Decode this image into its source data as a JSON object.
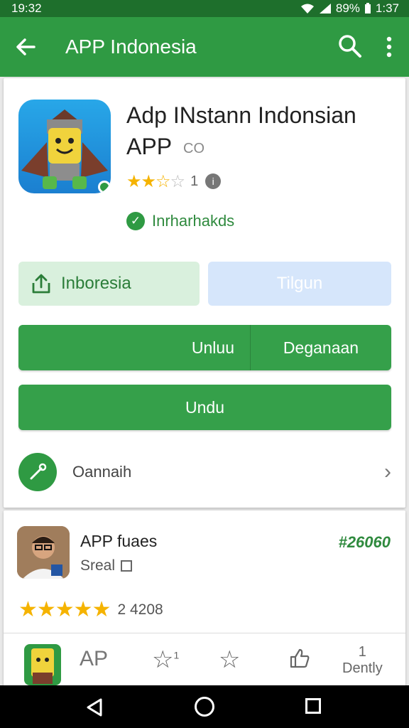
{
  "status_bar": {
    "time": "19:32",
    "battery": "89%",
    "clock": "1:37"
  },
  "app_bar": {
    "title": "APP Indonesia"
  },
  "app": {
    "title": "Adp INstann Indonsian APP",
    "badge": "CO",
    "rating_count": "1",
    "installed_label": "Inrharhakds",
    "share_label": "Inboresia",
    "secondary_label": "Tilgun",
    "split_left": "Unluu",
    "split_right": "Deganaan",
    "full_button": "Undu",
    "link_label": "Oannaih",
    "rating_value": 2.5
  },
  "developer": {
    "name": "APP fuaes",
    "subtitle": "Sreal",
    "price": "#26060",
    "rating_count": "2 4208"
  },
  "bottom_row": {
    "ap_label": "AP",
    "star_sup": "1",
    "right_top": "1",
    "right_label": "Dently"
  },
  "colors": {
    "primary": "#2f9a43",
    "primary_dark": "#1e6f2c",
    "star": "#f5b300"
  }
}
